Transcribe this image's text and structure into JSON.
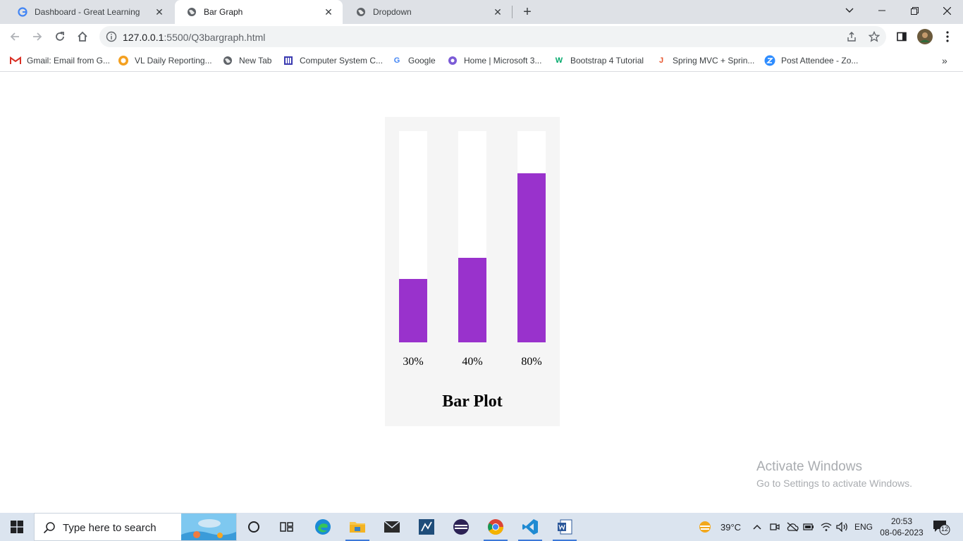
{
  "browser": {
    "tabs": [
      {
        "title": "Dashboard - Great Learning",
        "icon": "google-icon",
        "active": false
      },
      {
        "title": "Bar Graph",
        "icon": "globe-icon",
        "active": true
      },
      {
        "title": "Dropdown",
        "icon": "globe-icon",
        "active": false
      }
    ],
    "url_host": "127.0.0.1",
    "url_path": ":5500/Q3bargraph.html",
    "bookmarks": [
      {
        "label": "Gmail: Email from G...",
        "icon": "gmail-icon",
        "color": "#d93025"
      },
      {
        "label": "VL Daily Reporting...",
        "icon": "sun-icon",
        "color": "#f4a020"
      },
      {
        "label": "New Tab",
        "icon": "globe-icon",
        "color": "#5f6368"
      },
      {
        "label": "Computer System C...",
        "icon": "building-icon",
        "color": "#3a3ab0"
      },
      {
        "label": "Google",
        "icon": "google-icon",
        "color": "#4285f4"
      },
      {
        "label": "Home | Microsoft 3...",
        "icon": "office-icon",
        "color": "#7b5bd6"
      },
      {
        "label": "Bootstrap 4 Tutorial",
        "icon": "w3schools-icon",
        "color": "#04aa6d"
      },
      {
        "label": "Spring MVC + Sprin...",
        "icon": "javatpoint-icon",
        "color": "#e8542c"
      },
      {
        "label": "Post Attendee - Zo...",
        "icon": "zoom-icon",
        "color": "#2d8cff"
      }
    ]
  },
  "chart_data": {
    "type": "bar",
    "categories": [
      "30%",
      "40%",
      "80%"
    ],
    "values": [
      30,
      40,
      80
    ],
    "title": "Bar Plot",
    "ylim": [
      0,
      100
    ],
    "bar_color": "#9932cc",
    "track_color": "#ffffff",
    "background": "#f5f5f5"
  },
  "watermark": {
    "line1": "Activate Windows",
    "line2": "Go to Settings to activate Windows."
  },
  "taskbar": {
    "search_placeholder": "Type here to search",
    "weather": "39°C",
    "language": "ENG",
    "time": "20:53",
    "date": "08-06-2023",
    "notification_count": "12"
  }
}
